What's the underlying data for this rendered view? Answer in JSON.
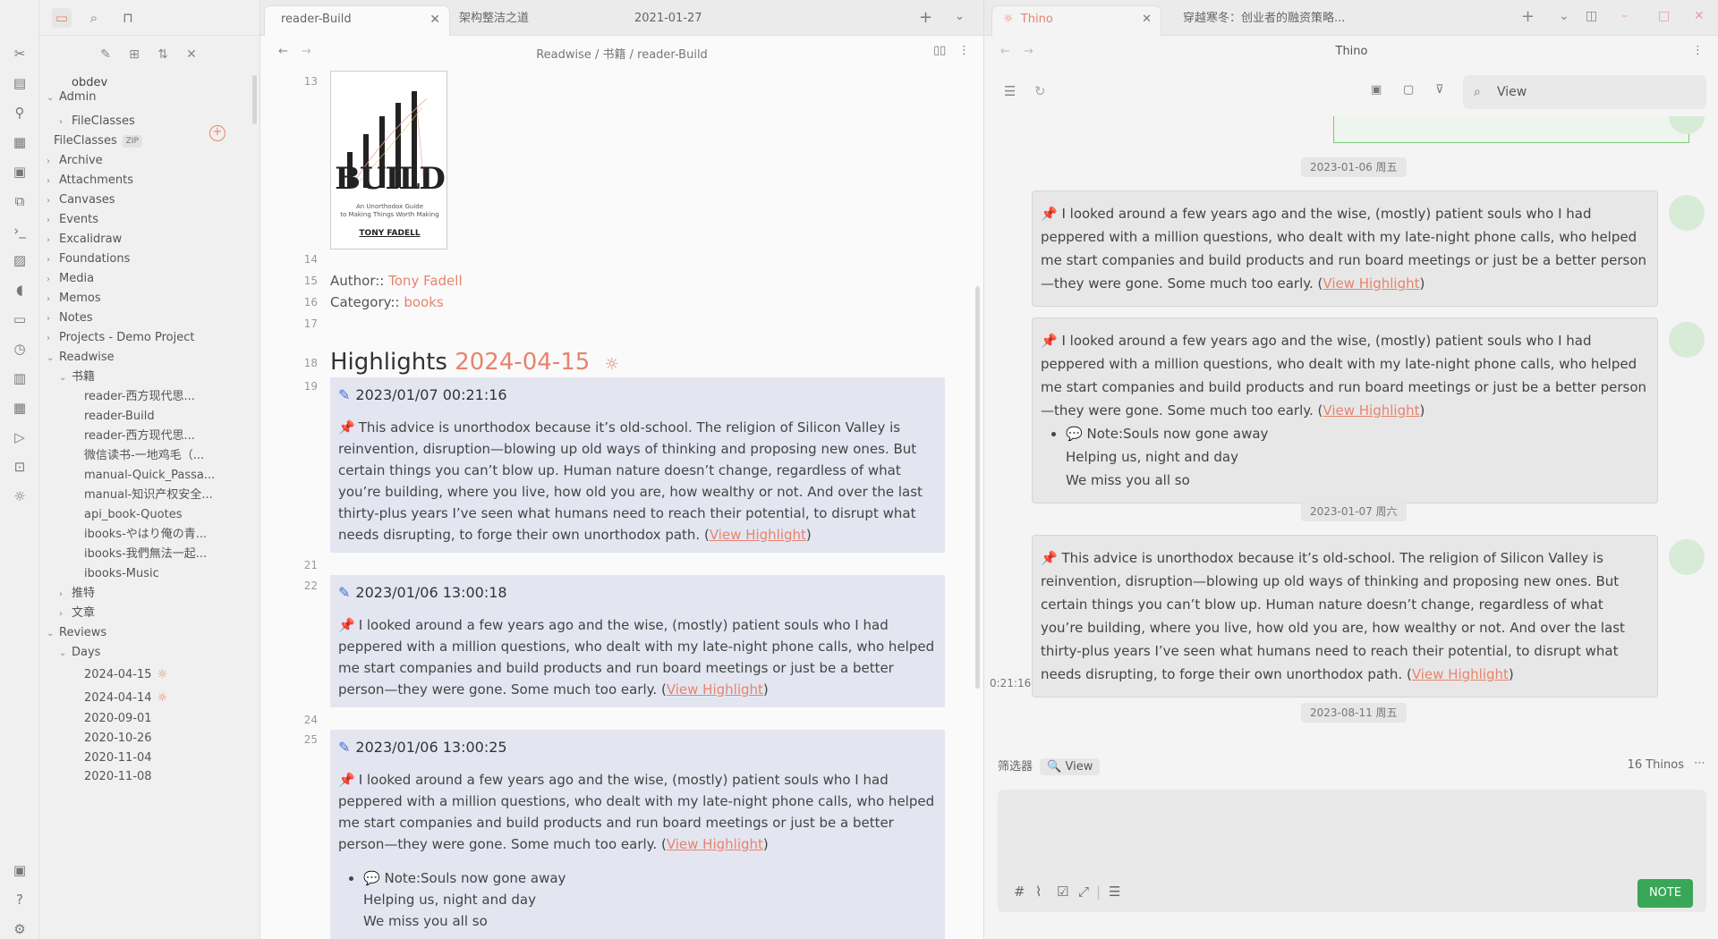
{
  "sidebar": {
    "vault_name": "obdev",
    "items": [
      {
        "label": "Admin",
        "chev": "⌄"
      },
      {
        "label": "FileClasses",
        "chev": "›"
      },
      {
        "label": "FileClasses",
        "badge": "ZIP"
      },
      {
        "label": "Archive",
        "chev": "›"
      },
      {
        "label": "Attachments",
        "chev": "›"
      },
      {
        "label": "Canvases",
        "chev": "›"
      },
      {
        "label": "Events",
        "chev": "›"
      },
      {
        "label": "Excalidraw",
        "chev": "›"
      },
      {
        "label": "Foundations",
        "chev": "›"
      },
      {
        "label": "Media",
        "chev": "›"
      },
      {
        "label": "Memos",
        "chev": "›"
      },
      {
        "label": "Notes",
        "chev": "›"
      },
      {
        "label": "Projects - Demo Project",
        "chev": "›"
      },
      {
        "label": "Readwise",
        "chev": "⌄"
      },
      {
        "label": "书籍",
        "chev": "⌄"
      },
      {
        "label": "reader-西方现代思..."
      },
      {
        "label": "reader-Build"
      },
      {
        "label": "reader-西方现代思..."
      },
      {
        "label": "微信读书-一地鸡毛（..."
      },
      {
        "label": "manual-Quick_Passa..."
      },
      {
        "label": "manual-知识产权安全..."
      },
      {
        "label": "api_book-Quotes"
      },
      {
        "label": "ibooks-やはり俺の青..."
      },
      {
        "label": "ibooks-我們無法一起..."
      },
      {
        "label": "ibooks-Music"
      },
      {
        "label": "推特",
        "chev": "›"
      },
      {
        "label": "文章",
        "chev": "›"
      },
      {
        "label": "Reviews",
        "chev": "⌄"
      },
      {
        "label": "Days",
        "chev": "⌄"
      },
      {
        "label": "2024-04-15",
        "sun": true
      },
      {
        "label": "2024-04-14",
        "sun": true
      },
      {
        "label": "2020-09-01"
      },
      {
        "label": "2020-10-26"
      },
      {
        "label": "2020-11-04"
      },
      {
        "label": "2020-11-08"
      }
    ]
  },
  "editor": {
    "tabs": [
      {
        "label": "reader-Build",
        "close": "✕"
      },
      {
        "label": "架构整洁之道"
      },
      {
        "label": "2021-01-27"
      }
    ],
    "breadcrumb": "Readwise / 书籍 / reader-Build",
    "line_numbers": [
      "13",
      "14",
      "15",
      "16",
      "17",
      "18",
      "19",
      "21",
      "22",
      "24",
      "25"
    ],
    "cover": {
      "title": "BUILD",
      "subtitle_1": "An Unorthodox Guide",
      "subtitle_2": "to Making Things Worth Making",
      "author": "TONY FADELL"
    },
    "author_label": "Author::",
    "author_value": "Tony Fadell",
    "category_label": "Category::",
    "category_value": "books",
    "heading": "Highlights",
    "heading_date": "2024-04-15",
    "highlights": [
      {
        "time": "2023/01/07 00:21:16",
        "text": "This advice is unorthodox because it’s old-school. The religion of Silicon Valley is reinvention, disruption—blowing up old ways of thinking and proposing new ones. But certain things you can’t blow up. Human nature doesn’t change, regardless of what you’re building, where you live, how old you are, how wealthy or not. And over the last thirty-plus years I’ve seen what humans need to reach their potential, to disrupt what needs disrupting, to forge their own unorthodox path. (",
        "link": "View Highlight",
        "close": ")"
      },
      {
        "time": "2023/01/06 13:00:18",
        "text": "I looked around a few years ago and the wise, (mostly) patient souls who I had peppered with a million questions, who dealt with my late-night phone calls, who helped me start companies and build products and run board meetings or just be a better person—they were gone. Some much too early. (",
        "link": "View Highlight",
        "close": ")"
      },
      {
        "time": "2023/01/06 13:00:25",
        "text": "I looked around a few years ago and the wise, (mostly) patient souls who I had peppered with a million questions, who dealt with my late-night phone calls, who helped me start companies and build products and run board meetings or just be a better person—they were gone. Some much too early. (",
        "link": "View Highlight",
        "close": ")",
        "note": [
          "Note:Souls now gone away",
          "Helping us, night and day",
          "We miss you all so"
        ]
      }
    ]
  },
  "thino": {
    "tabs": [
      {
        "label": "Thino",
        "close": "✕"
      },
      {
        "label": "穿越寒冬：创业者的融资策略..."
      }
    ],
    "title": "Thino",
    "search_value": "View",
    "dates": [
      "2023-01-06 周五",
      "2023-01-07 周六",
      "2023-08-11 周五"
    ],
    "cards": [
      {
        "text": "I looked around a few years ago and the wise, (mostly) patient souls who I had peppered with a million questions, who dealt with my late-night phone calls, who helped me start companies and build products and run board meetings or just be a better person—they were gone. Some much too early. (",
        "link": "View Highlight",
        "close": ")"
      },
      {
        "text": "I looked around a few years ago and the wise, (mostly) patient souls who I had peppered with a million questions, who dealt with my late-night phone calls, who helped me start companies and build products and run board meetings or just be a better person—they were gone. Some much too early. (",
        "link": "View Highlight",
        "close": ")",
        "note": [
          "Note:Souls now gone away",
          "Helping us, night and day",
          "We miss you all so"
        ]
      },
      {
        "text": "This advice is unorthodox because it’s old-school. The religion of Silicon Valley is reinvention, disruption—blowing up old ways of thinking and proposing new ones. But certain things you can’t blow up. Human nature doesn’t change, regardless of what you’re building, where you live, how old you are, how wealthy or not. And over the last thirty-plus years I’ve seen what humans need to reach their potential, to disrupt what needs disrupting, to forge their own unorthodox path. (",
        "link": "View Highlight",
        "close": ")"
      }
    ],
    "time_fragment": "0:21:16",
    "filter_label": "筛选器",
    "filter_chip": "View",
    "count": "16 Thinos",
    "note_button": "NOTE"
  },
  "colors": {
    "accent": "#e8836c",
    "highlight_bg": "#e3e6f1",
    "note_green": "#3aa657"
  },
  "icons": [
    "sidebar-toggle-icon",
    "folder-icon",
    "search-icon",
    "bookmark-icon",
    "pencil-icon",
    "new-folder-icon",
    "sort-icon",
    "collapse-icon",
    "close-icon",
    "plus-icon",
    "chevron-down-icon",
    "back-icon",
    "forward-icon",
    "reading-mode-icon",
    "more-icon",
    "menu-icon",
    "refresh-icon",
    "calendar-icon",
    "comment-icon",
    "filter-icon",
    "hash-icon",
    "paperclip-icon",
    "list-icon",
    "expand-icon",
    "settings-icon",
    "help-icon",
    "vault-icon"
  ]
}
